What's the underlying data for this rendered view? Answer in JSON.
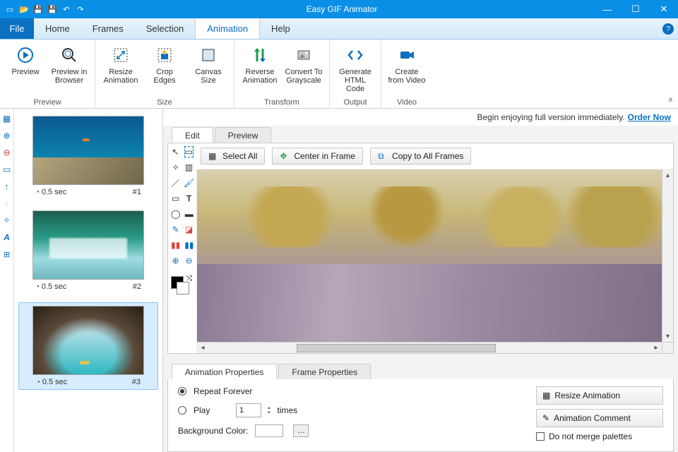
{
  "titlebar": {
    "title": "Easy GIF Animator"
  },
  "qat": [
    "new",
    "open",
    "save",
    "save-as",
    "undo",
    "redo"
  ],
  "menu": {
    "file": "File",
    "tabs": [
      "Home",
      "Frames",
      "Selection",
      "Animation",
      "Help"
    ],
    "active": "Animation"
  },
  "ribbon": {
    "groups": [
      {
        "label": "Preview",
        "items": [
          {
            "name": "preview",
            "label": "Preview"
          },
          {
            "name": "preview-browser",
            "label": "Preview in Browser"
          }
        ]
      },
      {
        "label": "Size",
        "items": [
          {
            "name": "resize-anim",
            "label": "Resize Animation"
          },
          {
            "name": "crop-edges",
            "label": "Crop Edges"
          },
          {
            "name": "canvas-size",
            "label": "Canvas Size"
          }
        ]
      },
      {
        "label": "Transform",
        "items": [
          {
            "name": "reverse-anim",
            "label": "Reverse Animation"
          },
          {
            "name": "to-grayscale",
            "label": "Convert To Grayscale"
          }
        ]
      },
      {
        "label": "Output",
        "items": [
          {
            "name": "gen-html",
            "label": "Generate HTML Code"
          }
        ]
      },
      {
        "label": "Video",
        "items": [
          {
            "name": "from-video",
            "label": "Create from Video"
          }
        ]
      }
    ]
  },
  "frames": [
    {
      "duration": "0.5 sec",
      "index": "#1"
    },
    {
      "duration": "0.5 sec",
      "index": "#2"
    },
    {
      "duration": "0.5 sec",
      "index": "#3"
    }
  ],
  "promo": {
    "text": "Begin enjoying full version immediately.",
    "link": "Order Now"
  },
  "editorTabs": {
    "edit": "Edit",
    "preview": "Preview"
  },
  "editToolbar": {
    "selectAll": "Select All",
    "centerFrame": "Center in Frame",
    "copyAll": "Copy to All Frames"
  },
  "propTabs": {
    "anim": "Animation Properties",
    "frame": "Frame Properties"
  },
  "anim": {
    "repeatForever": "Repeat Forever",
    "play": "Play",
    "playValue": "1",
    "times": "times",
    "bgLabel": "Background Color:",
    "resizeBtn": "Resize Animation",
    "commentBtn": "Animation Comment",
    "noMerge": "Do not merge palettes"
  }
}
